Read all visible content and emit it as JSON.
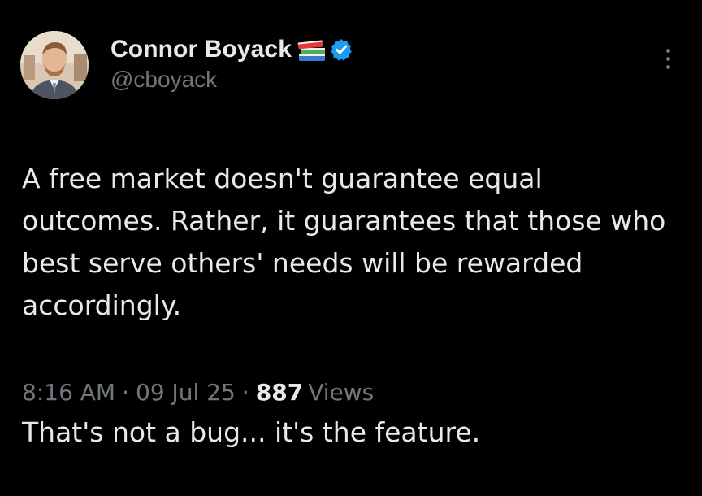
{
  "tweet": {
    "author": {
      "display_name": "Connor Boyack",
      "handle": "@cboyack",
      "name_emoji": "books-emoji",
      "verified_icon": "verified-badge-icon",
      "verified_color": "#1d9bf0"
    },
    "text": {
      "paragraph1": "A free market doesn't guarantee equal outcomes. Rather, it guarantees that those who best serve others' needs will be rewarded accordingly.",
      "paragraph2": "That's not a bug... it's the feature."
    },
    "meta": {
      "time": "8:16 AM",
      "separator": "·",
      "date": "09 Jul 25",
      "views_count": "887",
      "views_label": "Views"
    },
    "more_icon": "more-vertical-icon"
  },
  "colors": {
    "background": "#000000",
    "primary_text": "#e7e9ea",
    "secondary_text": "#71767b",
    "accent": "#1d9bf0"
  }
}
